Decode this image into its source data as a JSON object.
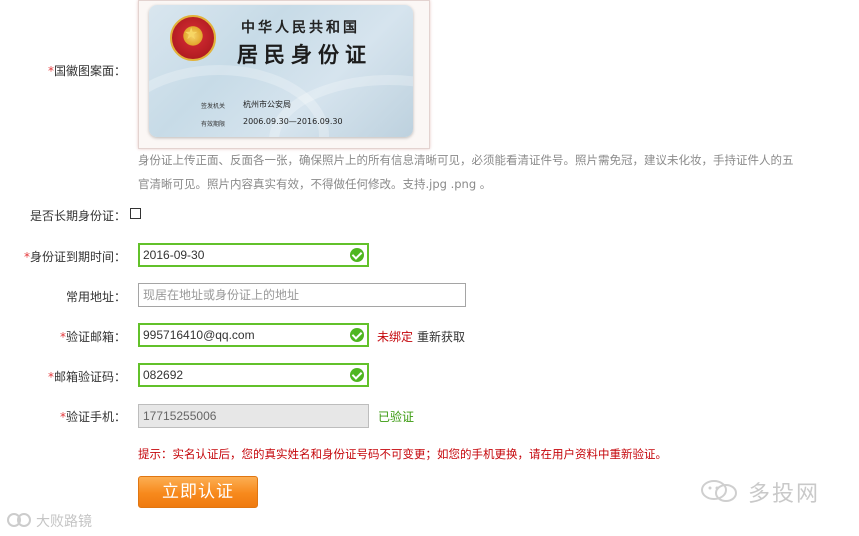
{
  "form": {
    "emblem_side": {
      "required_mark": "*",
      "label": "国徽图案面："
    },
    "id_card": {
      "country": "中华人民共和国",
      "title": "居民身份证",
      "issuer_key": "签发机关",
      "issuer_value": "杭州市公安局",
      "validity_key": "有效期限",
      "validity_value": "2006.09.30—2016.09.30"
    },
    "upload_hint_line1": "身份证上传正面、反面各一张，确保照片上的所有信息清晰可见，必须能看清证件号。照片需免冠，建议未化妆，手持证件人的五",
    "upload_hint_line2": "官清晰可见。照片内容真实有效，不得做任何修改。支持.jpg .png 。",
    "long_term": {
      "label": "是否长期身份证：",
      "checked": false
    },
    "expiry": {
      "required_mark": "*",
      "label": "身份证到期时间：",
      "value": "2016-09-30"
    },
    "address": {
      "label": "常用地址：",
      "placeholder": "现居在地址或身份证上的地址"
    },
    "email": {
      "required_mark": "*",
      "label": "验证邮箱：",
      "value": "995716410@qq.com",
      "status": "未绑定",
      "resend": "重新获取"
    },
    "email_code": {
      "required_mark": "*",
      "label": "邮箱验证码：",
      "value": "082692"
    },
    "phone": {
      "required_mark": "*",
      "label": "验证手机：",
      "value": "17715255006",
      "status": "已验证"
    },
    "tip": "提示：实名认证后，您的真实姓名和身份证号码不可变更；如您的手机更换，请在用户资料中重新验证。",
    "submit_label": "立即认证"
  },
  "watermarks": {
    "right": "多投网",
    "left": "大败路镜"
  },
  "colors": {
    "required": "#e4393c",
    "valid_border": "#62c12a",
    "check_icon": "#4fb620",
    "unbound": "#c5060b",
    "verified": "#3a9a0f",
    "tip": "#c5060b",
    "button": "#f7891c"
  },
  "icons": {
    "valid": "check-circle-icon",
    "watermark": "wechat-icon"
  }
}
